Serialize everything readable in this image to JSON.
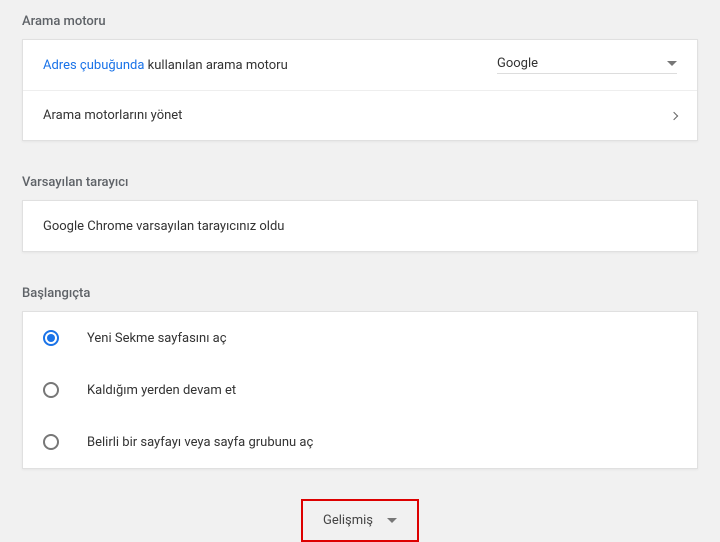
{
  "sections": {
    "searchEngine": {
      "title": "Arama motoru",
      "addressBarLink": "Adres çubuğunda",
      "addressBarRest": " kullanılan arama motoru",
      "selectedEngine": "Google",
      "manageLabel": "Arama motorlarını yönet"
    },
    "defaultBrowser": {
      "title": "Varsayılan tarayıcı",
      "statusText": "Google Chrome varsayılan tarayıcınız oldu"
    },
    "onStartup": {
      "title": "Başlangıçta",
      "options": [
        {
          "label": "Yeni Sekme sayfasını aç",
          "selected": true
        },
        {
          "label": "Kaldığım yerden devam et",
          "selected": false
        },
        {
          "label": "Belirli bir sayfayı veya sayfa grubunu aç",
          "selected": false
        }
      ]
    }
  },
  "advancedLabel": "Gelişmiş"
}
